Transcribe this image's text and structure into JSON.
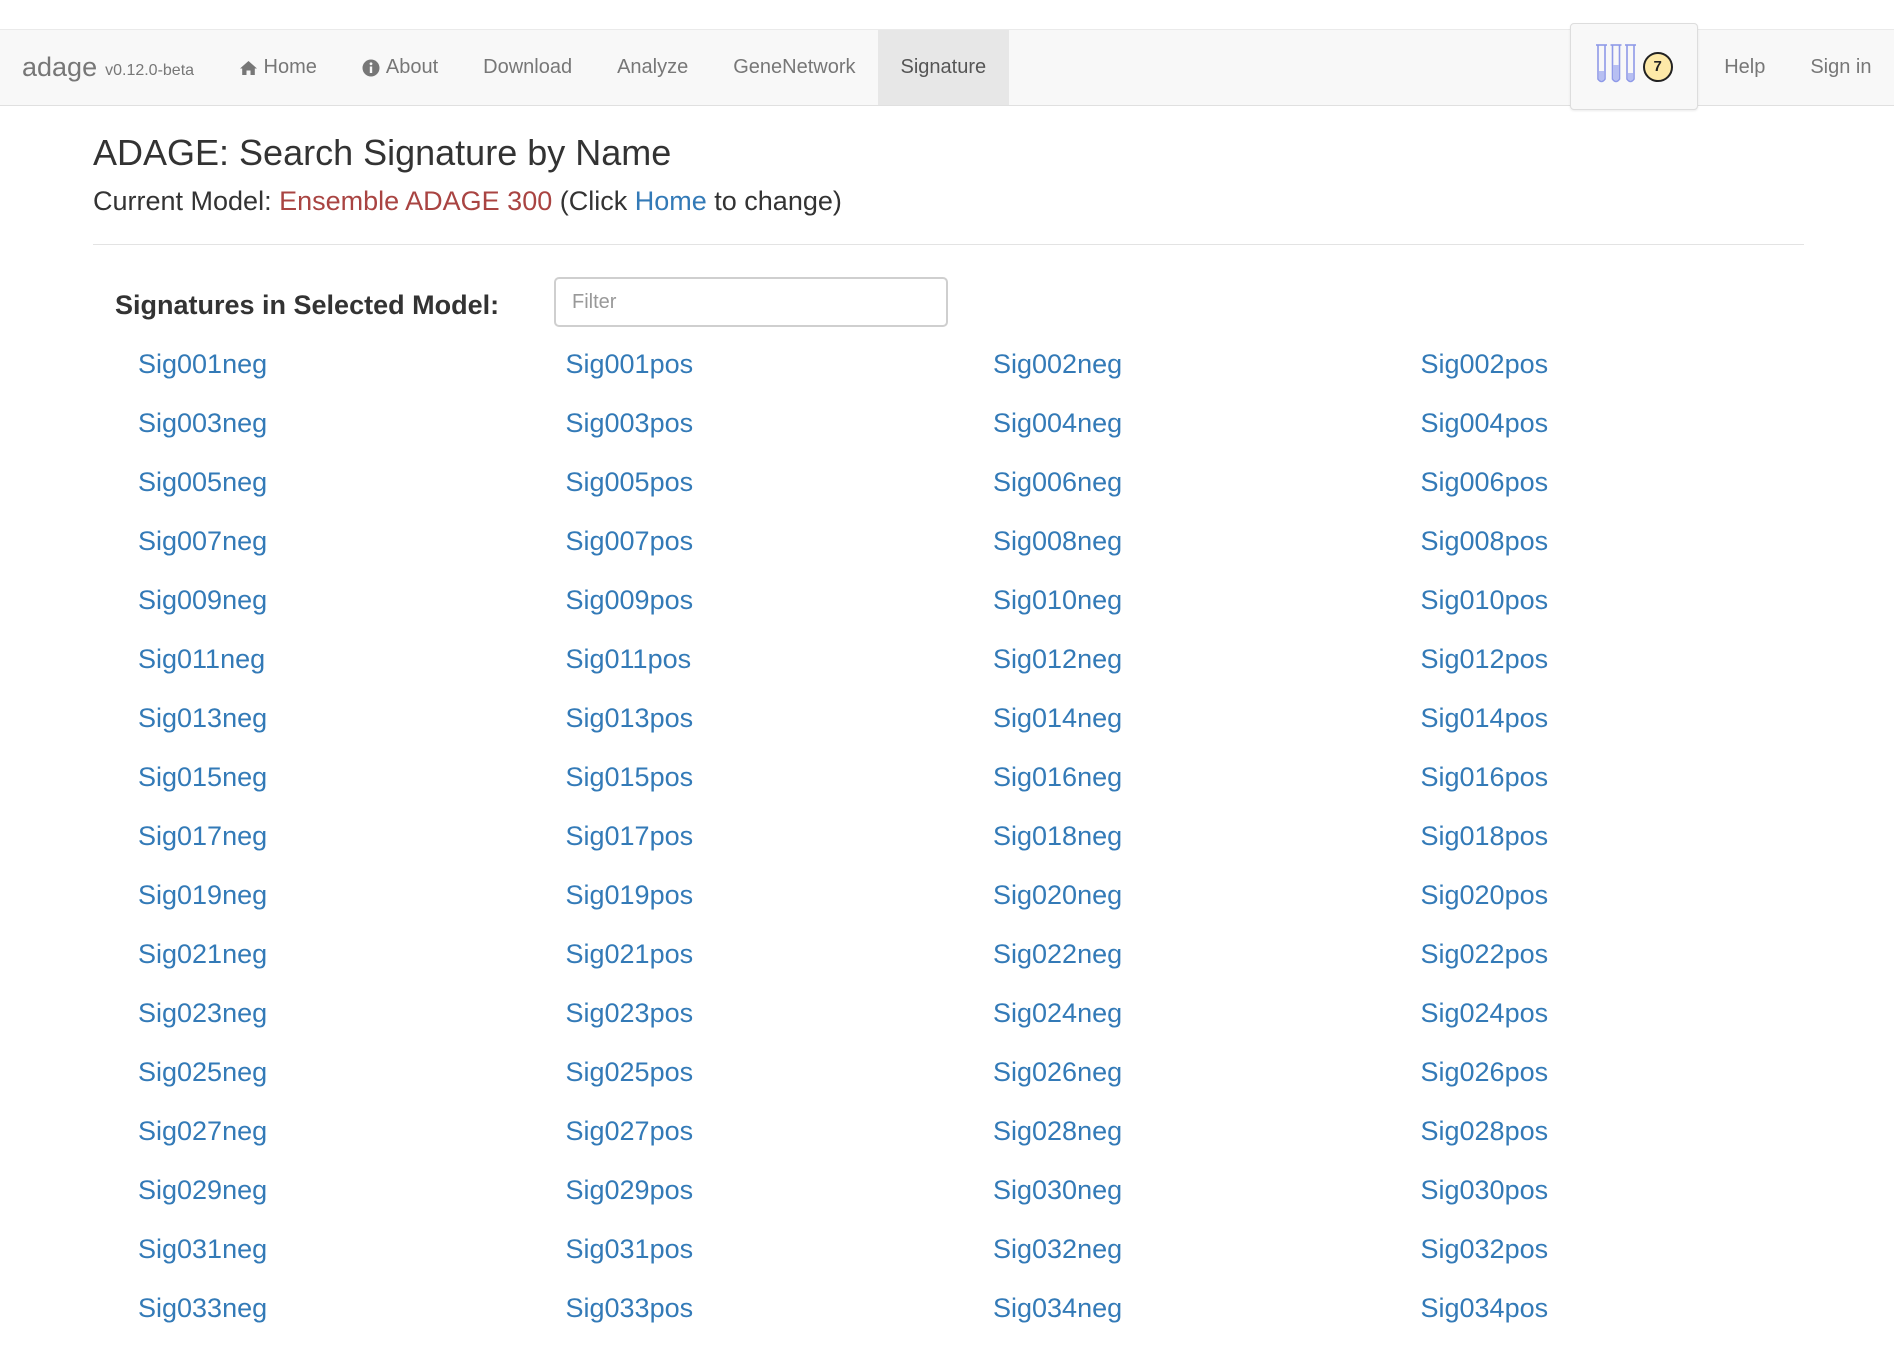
{
  "nav": {
    "brand": "adage",
    "version": "v0.12.0-beta",
    "items": [
      {
        "label": "Home",
        "icon": "home-icon"
      },
      {
        "label": "About",
        "icon": "info-icon"
      },
      {
        "label": "Download"
      },
      {
        "label": "Analyze"
      },
      {
        "label": "GeneNetwork"
      },
      {
        "label": "Signature",
        "active": true
      }
    ],
    "basket_count": "7",
    "help": "Help",
    "signin": "Sign in"
  },
  "page": {
    "title": "ADAGE: Search Signature by Name",
    "model_prefix": "Current Model: ",
    "model_name": "Ensemble ADAGE 300",
    "click_text": " (Click ",
    "home_link": "Home",
    "change_text": " to change)",
    "signatures_label": "Signatures in Selected Model:",
    "filter_placeholder": "Filter"
  },
  "signatures": [
    "Sig001neg",
    "Sig001pos",
    "Sig002neg",
    "Sig002pos",
    "Sig003neg",
    "Sig003pos",
    "Sig004neg",
    "Sig004pos",
    "Sig005neg",
    "Sig005pos",
    "Sig006neg",
    "Sig006pos",
    "Sig007neg",
    "Sig007pos",
    "Sig008neg",
    "Sig008pos",
    "Sig009neg",
    "Sig009pos",
    "Sig010neg",
    "Sig010pos",
    "Sig011neg",
    "Sig011pos",
    "Sig012neg",
    "Sig012pos",
    "Sig013neg",
    "Sig013pos",
    "Sig014neg",
    "Sig014pos",
    "Sig015neg",
    "Sig015pos",
    "Sig016neg",
    "Sig016pos",
    "Sig017neg",
    "Sig017pos",
    "Sig018neg",
    "Sig018pos",
    "Sig019neg",
    "Sig019pos",
    "Sig020neg",
    "Sig020pos",
    "Sig021neg",
    "Sig021pos",
    "Sig022neg",
    "Sig022pos",
    "Sig023neg",
    "Sig023pos",
    "Sig024neg",
    "Sig024pos",
    "Sig025neg",
    "Sig025pos",
    "Sig026neg",
    "Sig026pos",
    "Sig027neg",
    "Sig027pos",
    "Sig028neg",
    "Sig028pos",
    "Sig029neg",
    "Sig029pos",
    "Sig030neg",
    "Sig030pos",
    "Sig031neg",
    "Sig031pos",
    "Sig032neg",
    "Sig032pos",
    "Sig033neg",
    "Sig033pos",
    "Sig034neg",
    "Sig034pos"
  ],
  "colors": {
    "link": "#337ab7",
    "model": "#a94442",
    "navbar_bg": "#f8f8f8",
    "active_tab_bg": "#e7e7e7",
    "badge_bg": "#fde9a8",
    "tube_color": "#8f9ae8"
  }
}
